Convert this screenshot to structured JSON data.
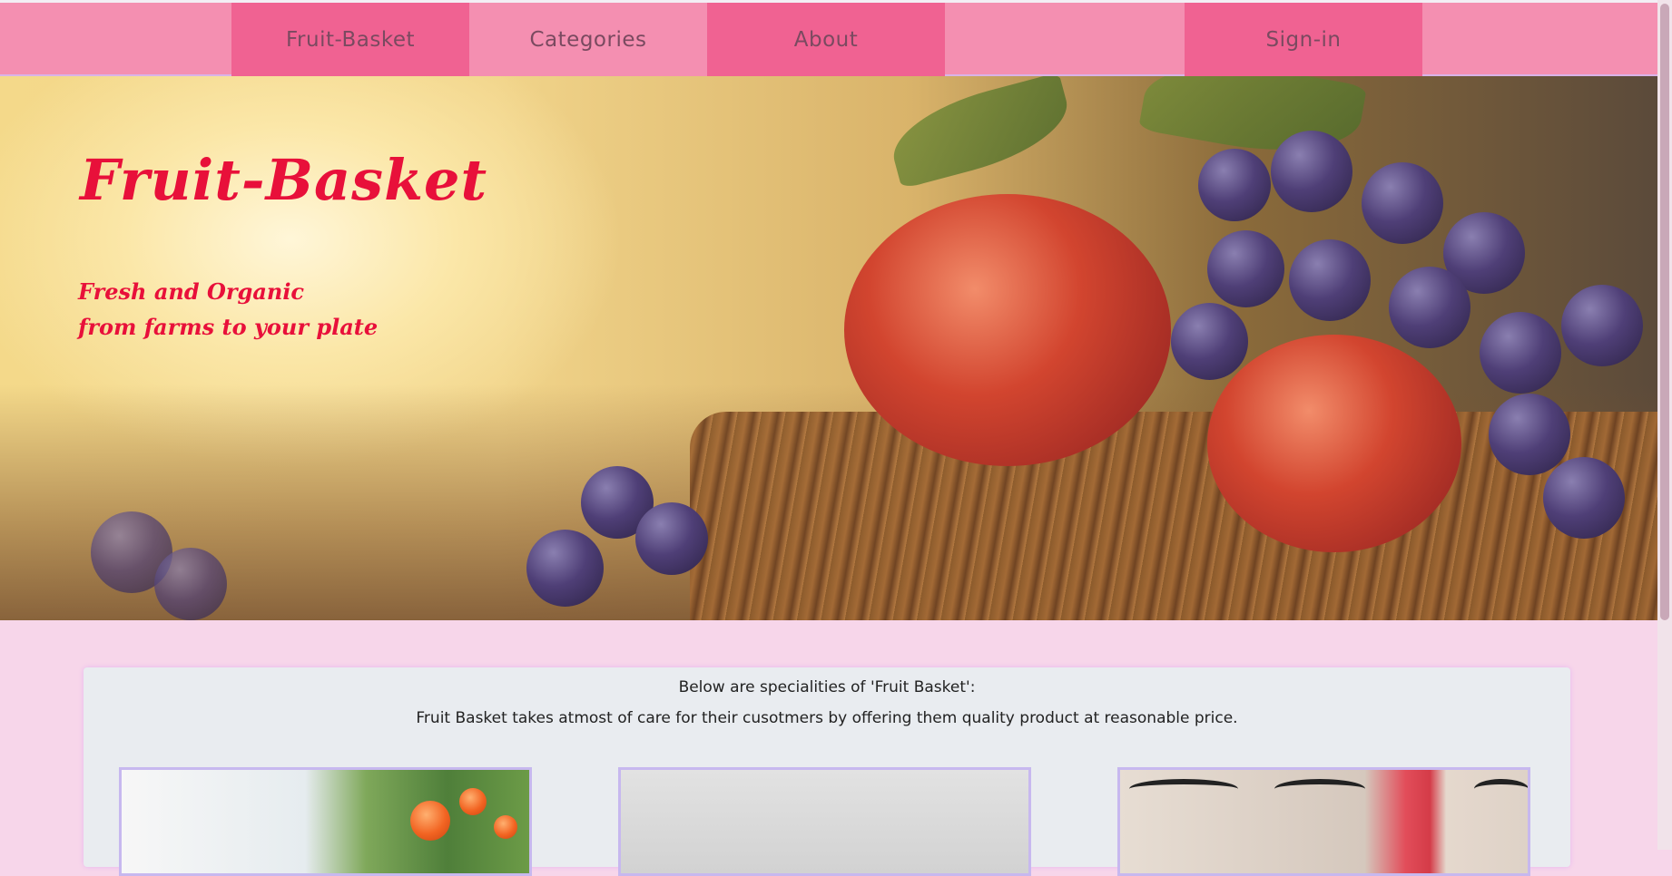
{
  "nav": {
    "items": [
      {
        "label": "Fruit-Basket"
      },
      {
        "label": "Categories"
      },
      {
        "label": "About"
      },
      {
        "label": "Sign-in"
      }
    ]
  },
  "hero": {
    "title": "Fruit-Basket",
    "subtitle_line1": "Fresh and Organic",
    "subtitle_line2": "from farms to your plate"
  },
  "specialities": {
    "heading": "Below are specialities of 'Fruit Basket':",
    "description": "Fruit Basket takes atmost of care for their cusotmers by offering them quality product at reasonable price."
  },
  "colors": {
    "nav_bg": "#f48fb1",
    "nav_active": "#f06292",
    "page_bg": "#f7d6ea",
    "title_red": "#e8103a",
    "card_bg": "#e9ecf0"
  }
}
